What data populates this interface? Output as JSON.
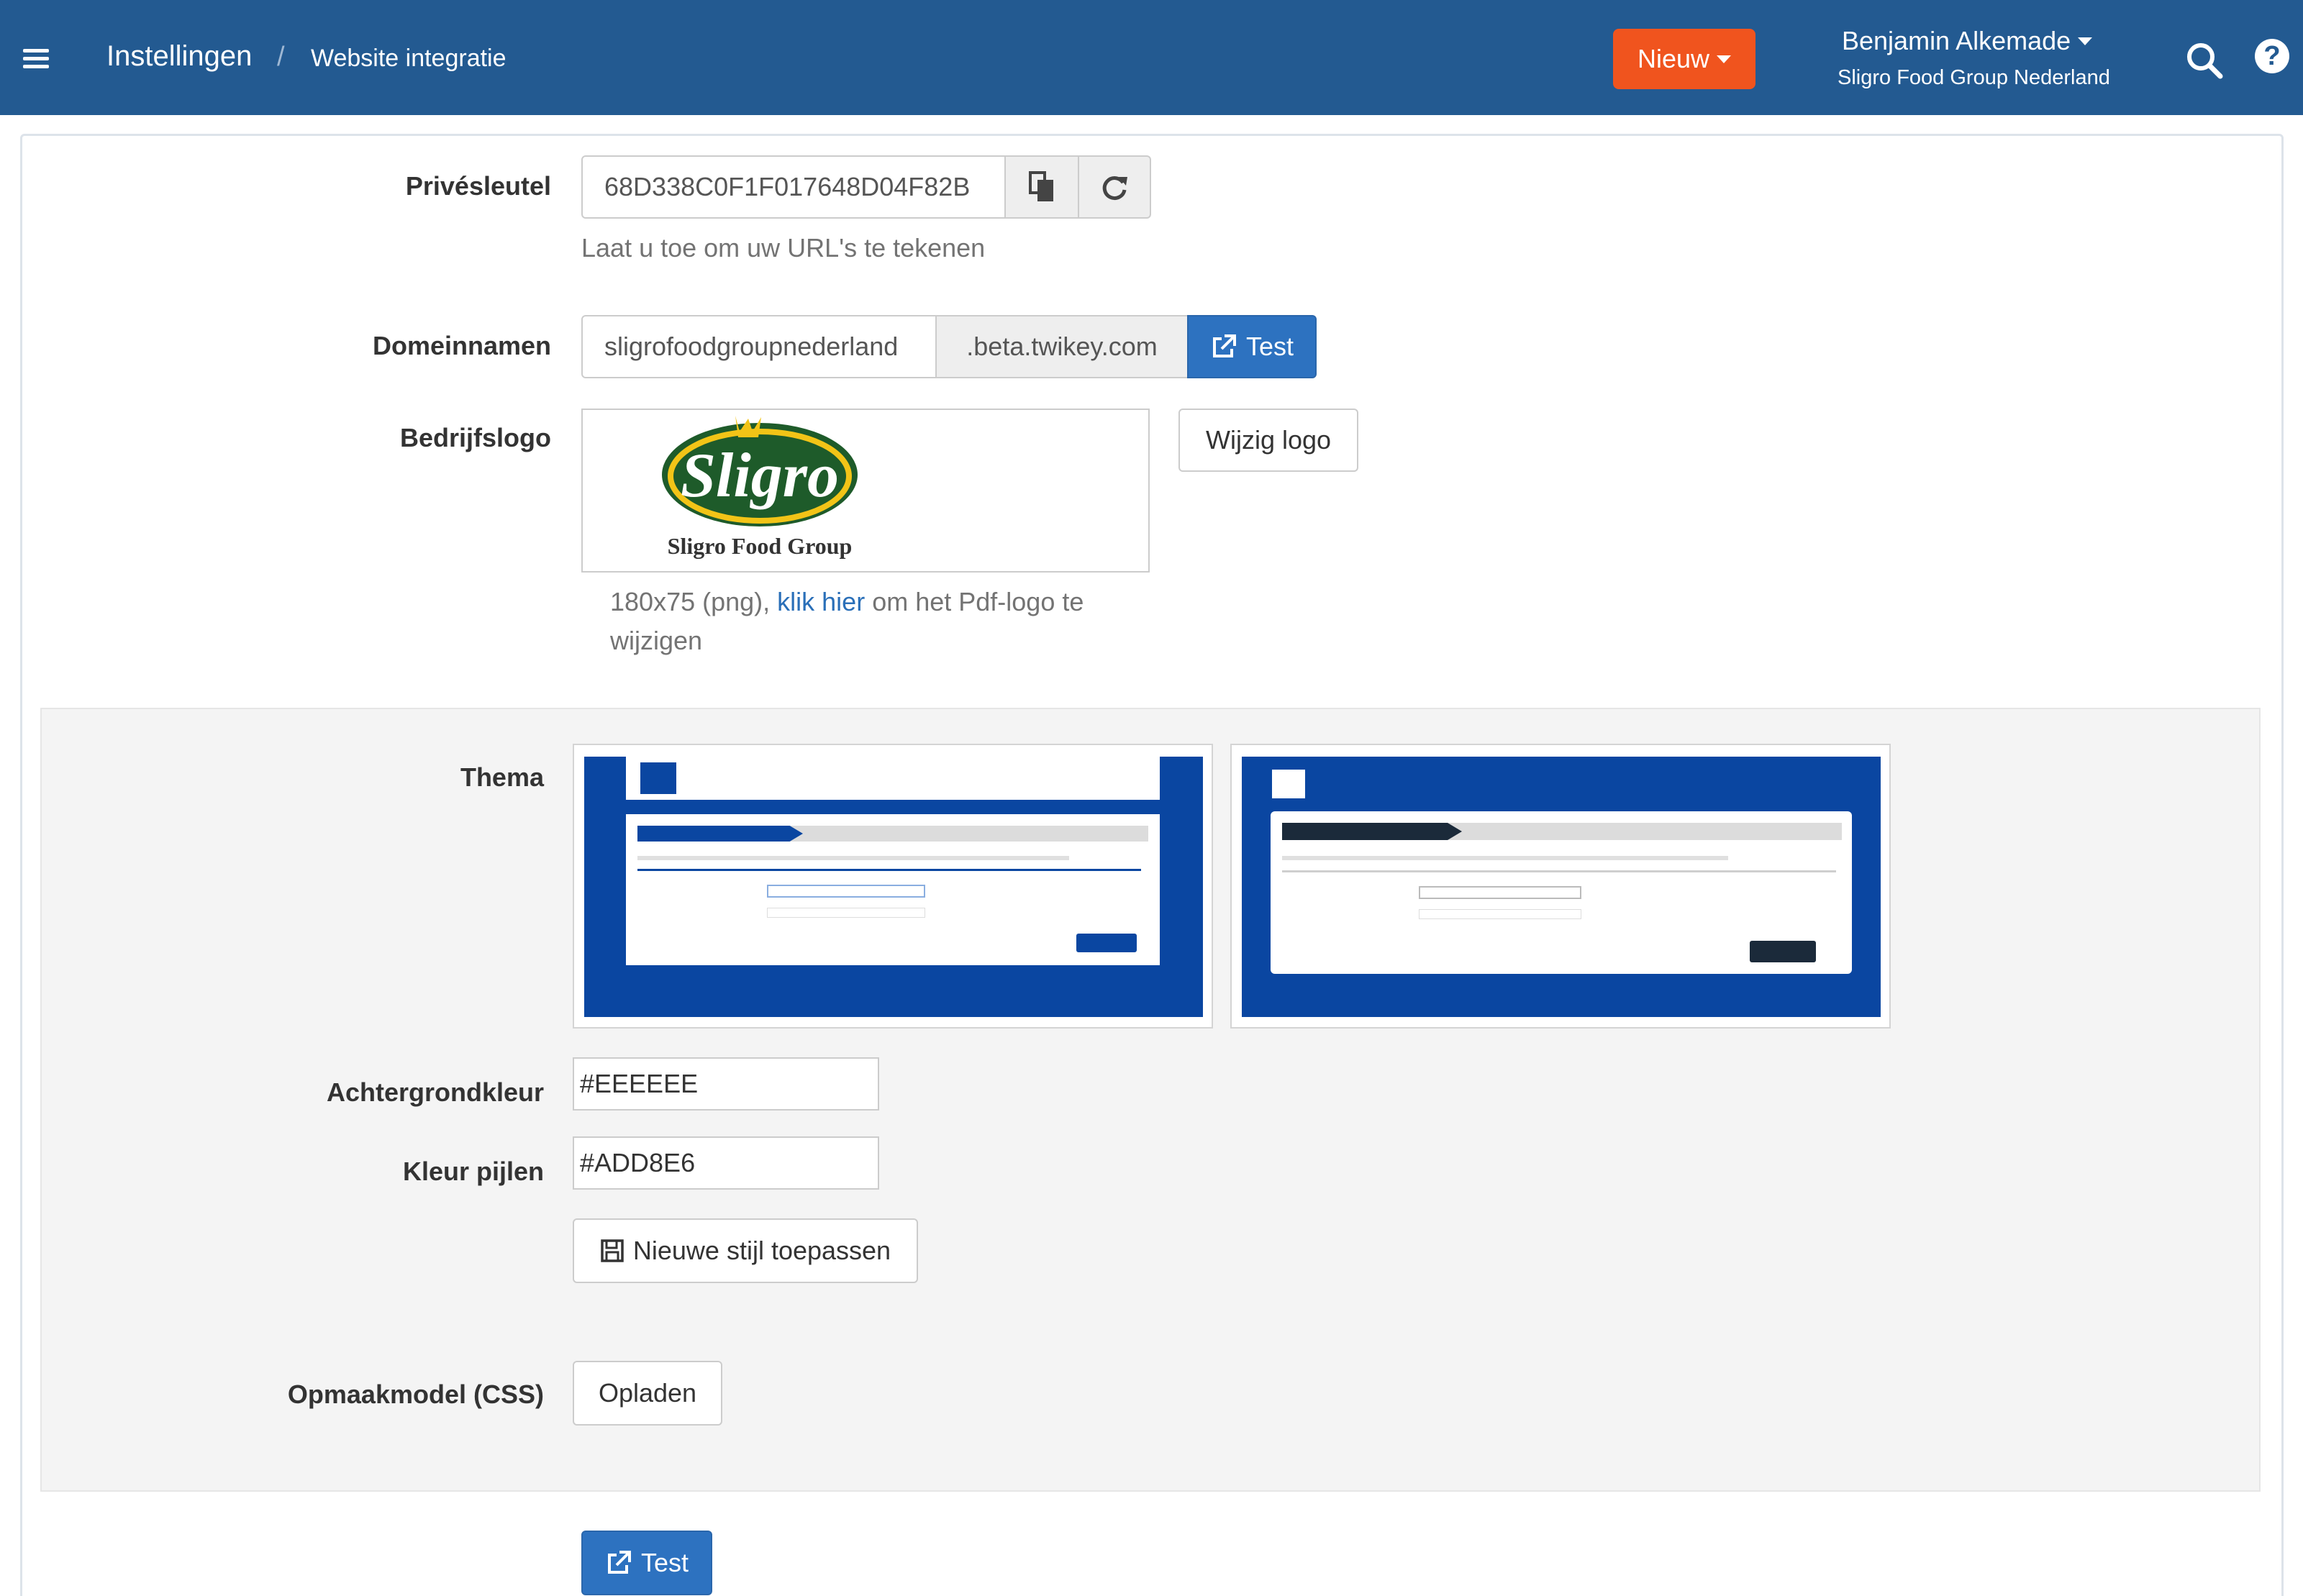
{
  "header": {
    "breadcrumb_home": "Instellingen",
    "breadcrumb_separator": "/",
    "breadcrumb_current": "Website integratie",
    "new_button_label": "Nieuw",
    "user_name": "Benjamin Alkemade",
    "user_org": "Sligro Food Group Nederland",
    "menu_icon": "hamburger-icon",
    "search_icon": "search-icon",
    "help_icon": "help-icon",
    "help_glyph": "?"
  },
  "private_key": {
    "label": "Privésleutel",
    "value": "68D338C0F1F017648D04F82B",
    "help": "Laat u toe om uw URL's te tekenen",
    "copy_icon": "copy-icon",
    "refresh_icon": "refresh-icon"
  },
  "domain": {
    "label": "Domeinnamen",
    "value": "sligrofoodgroupnederland",
    "suffix": ".beta.twikey.com",
    "test_label": "Test"
  },
  "logo": {
    "label": "Bedrijfslogo",
    "logo_text": "Sligro",
    "logo_subtext": "Sligro Food Group",
    "change_label": "Wijzig logo",
    "help_prefix": "180x75 (png), ",
    "help_link": "klik hier",
    "help_suffix": " om het Pdf-logo te",
    "help_line2": "wijzigen"
  },
  "theme": {
    "label": "Thema",
    "background_label": "Achtergrondkleur",
    "background_value": "#EEEEEE",
    "arrow_label": "Kleur pijlen",
    "arrow_value": "#ADD8E6",
    "apply_label": "Nieuwe stijl toepassen",
    "css_label": "Opmaakmodel (CSS)",
    "upload_label": "Opladen"
  },
  "footer": {
    "test_label": "Test"
  },
  "colors": {
    "navbar": "#235a91",
    "accent_new": "#f0541e",
    "primary": "#2d72c0",
    "theme_preview_blue": "#0a46a1"
  }
}
